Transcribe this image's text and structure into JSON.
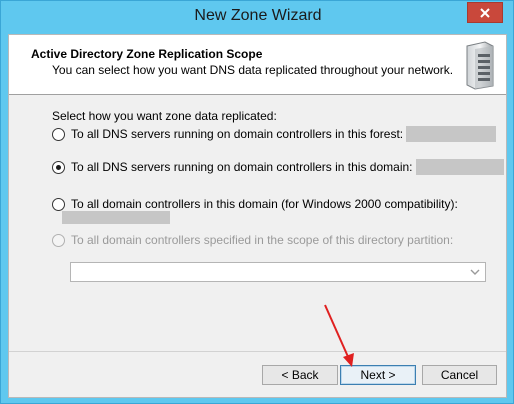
{
  "window": {
    "title": "New Zone Wizard"
  },
  "header": {
    "title": "Active Directory Zone Replication Scope",
    "subtitle": "You can select how you want DNS data replicated throughout your network.",
    "icon": "server-icon"
  },
  "body": {
    "prompt": "Select how you want zone data replicated:",
    "options": [
      {
        "label": "To all DNS servers running on domain controllers in this forest:",
        "checked": false,
        "enabled": true
      },
      {
        "label": "To all DNS servers running on domain controllers in this domain:",
        "checked": true,
        "enabled": true
      },
      {
        "label": "To all domain controllers in this domain (for Windows 2000 compatibility):",
        "checked": false,
        "enabled": true
      },
      {
        "label": "To all domain controllers specified in the scope of this directory partition:",
        "checked": false,
        "enabled": false
      }
    ],
    "partition_select": {
      "value": "",
      "enabled": false
    }
  },
  "buttons": {
    "back": "< Back",
    "next": "Next >",
    "cancel": "Cancel"
  },
  "colors": {
    "title_bar": "#5fc8ef",
    "close_button": "#c9483b",
    "annotation_arrow": "#e02020"
  }
}
